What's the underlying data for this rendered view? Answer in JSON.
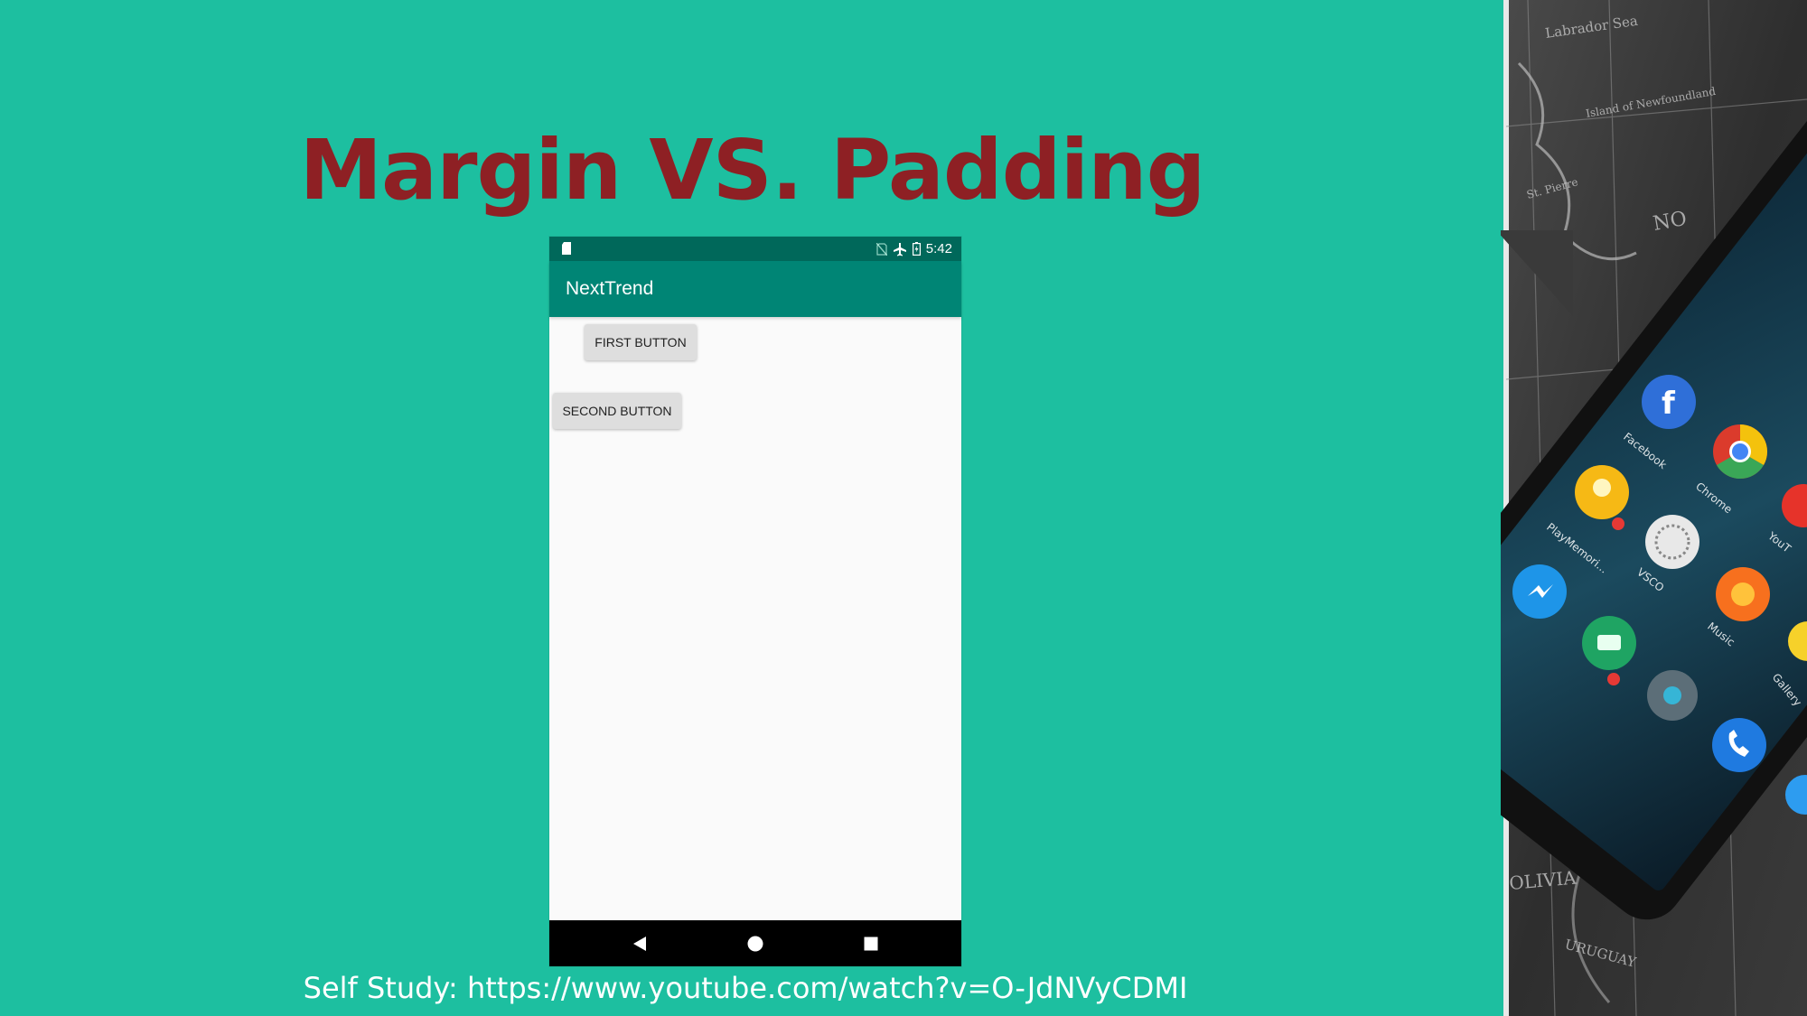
{
  "colors": {
    "background": "#1dbfa0",
    "title": "#8e2024",
    "app_bar": "#008575",
    "status_bar": "#00685a"
  },
  "slide": {
    "title": "Margin VS. Padding",
    "footer": "Self Study: https://www.youtube.com/watch?v=O-JdNVyCDMI"
  },
  "phone": {
    "status_bar": {
      "time": "5:42",
      "icons": [
        "sd-card-icon",
        "no-sim-icon",
        "airplane-icon",
        "battery-icon"
      ]
    },
    "app_title": "NextTrend",
    "buttons": {
      "first": "FIRST BUTTON",
      "second": "SECOND BUTTON"
    },
    "nav_icons": [
      "back-icon",
      "home-icon",
      "recents-icon"
    ]
  },
  "decor": {
    "app_labels": [
      "Facebook",
      "Chrome",
      "PlayMemori...",
      "VSCO",
      "Music",
      "YouT",
      "Gallery"
    ],
    "map_labels": [
      "Labrador Sea",
      "Island of Newfoundland",
      "St. Pierre",
      "NO",
      "OLIVIA",
      "URUGUAY"
    ]
  }
}
